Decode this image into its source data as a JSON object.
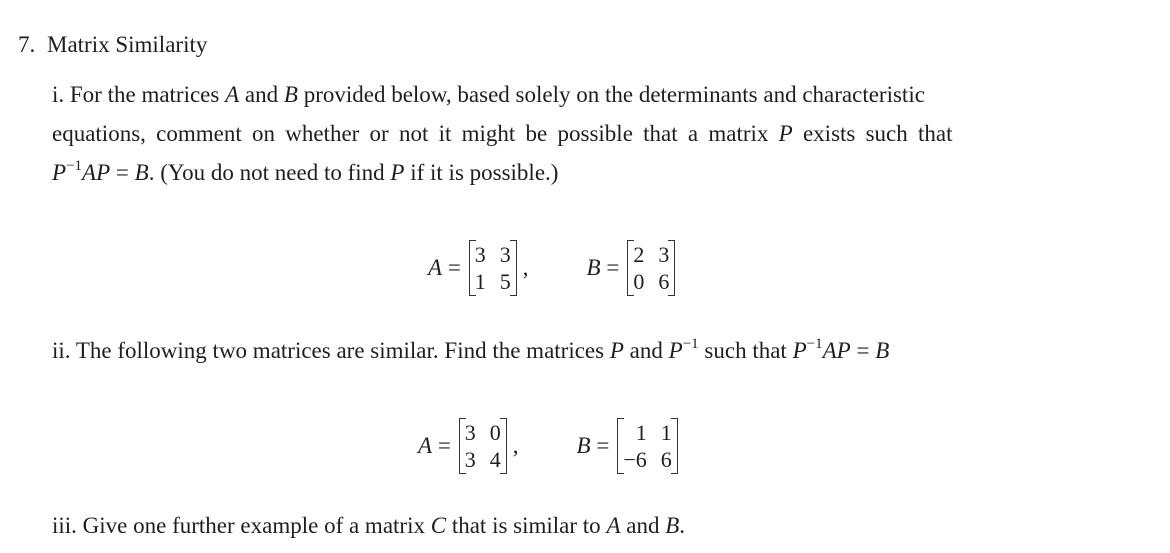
{
  "question": {
    "number": "7.",
    "title": "Matrix Similarity",
    "part_i": {
      "line1_a": "i. For the matrices ",
      "A": "A",
      "and": " and ",
      "B": "B",
      "line1_b": " provided below, based solely on the determinants and characteristic",
      "line2": "equations, comment on whether or not it might be possible that a matrix ",
      "P": "P",
      "line2_end": " exists such that",
      "line3_P": "P",
      "line3_exp": "−1",
      "line3_AP": "AP",
      "line3_eq": " = ",
      "line3_B": "B",
      "line3_rest": ". (You do not need to find ",
      "line3_rest2": " if it is possible.)",
      "matrixA": {
        "name": "A",
        "eq": "=",
        "values": [
          "3",
          "3",
          "1",
          "5"
        ]
      },
      "matrixB": {
        "name": "B",
        "eq": "=",
        "values": [
          "2",
          "3",
          "0",
          "6"
        ]
      }
    },
    "part_ii": {
      "text_a": "ii. The following two matrices are similar. Find the matrices ",
      "P": "P",
      "and": " and ",
      "exp": "−1",
      "such": " such that ",
      "AP": "AP",
      "eq": " = ",
      "B": "B",
      "matrixA": {
        "name": "A",
        "eq": "=",
        "values": [
          "3",
          "0",
          "3",
          "4"
        ]
      },
      "matrixB": {
        "name": "B",
        "eq": "=",
        "values": [
          "1",
          "1",
          "−6",
          "6"
        ]
      }
    },
    "part_iii": {
      "text_a": "iii. Give one further example of a matrix ",
      "C": "C",
      "text_b": " that is similar to ",
      "A": "A",
      "and": " and ",
      "B": "B",
      "end": "."
    },
    "comma": ","
  }
}
